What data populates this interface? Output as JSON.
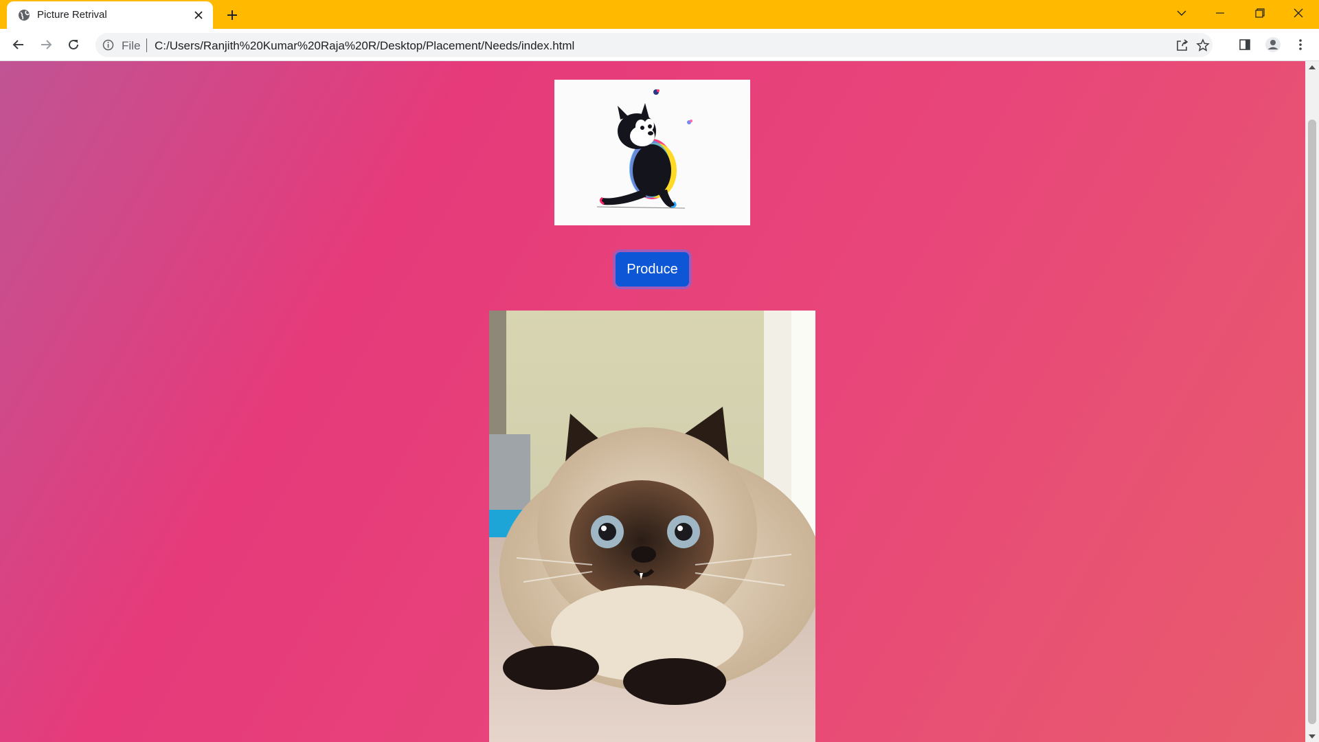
{
  "browser": {
    "tab": {
      "title": "Picture Retrival"
    },
    "address": {
      "scheme": "File",
      "url": "C:/Users/Ranjith%20Kumar%20Raja%20R/Desktop/Placement/Needs/index.html"
    },
    "frame_color": "#FFBA00",
    "icons": [
      "globe-icon",
      "close-icon",
      "plus-icon",
      "chevron-down-icon",
      "minimize-icon",
      "restore-icon",
      "close-window-icon",
      "back-icon",
      "forward-icon",
      "reload-icon",
      "info-icon",
      "share-icon",
      "star-icon",
      "side-panel-icon",
      "profile-icon",
      "kebab-menu-icon"
    ]
  },
  "page": {
    "produce_button": {
      "label": "Produce",
      "color": "#0d56d6"
    },
    "background_gradient": [
      "#c05494",
      "#e63a7a",
      "#e85c6c"
    ],
    "images": [
      "cartoon-cat-image",
      "persian-cat-photo"
    ]
  }
}
